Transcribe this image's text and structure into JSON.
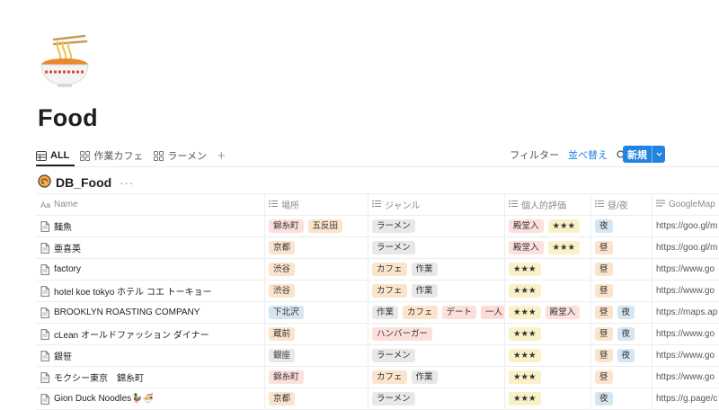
{
  "page": {
    "icon": "noodle-bowl-icon",
    "title": "Food"
  },
  "views": {
    "tabs": [
      {
        "label": "ALL",
        "icon": "table-icon",
        "active": true
      },
      {
        "label": "作業カフェ",
        "icon": "gallery-icon",
        "active": false
      },
      {
        "label": "ラーメン",
        "icon": "gallery-icon",
        "active": false
      }
    ],
    "add": "+"
  },
  "toolbar": {
    "filter": "フィルター",
    "sort": "並べ替え",
    "new": "新規"
  },
  "database": {
    "icon": "noodle-bowl-icon",
    "title": "DB_Food",
    "more": "···"
  },
  "table": {
    "headers": {
      "name": "Name",
      "place": "場所",
      "genre": "ジャンル",
      "rating": "個人的評価",
      "time": "昼/夜",
      "gmap": "GoogleMap"
    },
    "rows": [
      {
        "name": "麺魚",
        "place": [
          "錦糸町",
          "五反田"
        ],
        "genre": [
          "ラーメン"
        ],
        "rating": [
          "殿堂入",
          "★★★"
        ],
        "time": [
          "夜"
        ],
        "gmap": "https://goo.gl/m"
      },
      {
        "name": "亜喜英",
        "place": [
          "京都"
        ],
        "genre": [
          "ラーメン"
        ],
        "rating": [
          "殿堂入",
          "★★★"
        ],
        "time": [
          "昼"
        ],
        "gmap": "https://goo.gl/m"
      },
      {
        "name": "factory",
        "place": [
          "渋谷"
        ],
        "genre": [
          "カフェ",
          "作業"
        ],
        "rating": [
          "★★★"
        ],
        "time": [
          "昼"
        ],
        "gmap": "https://www.go"
      },
      {
        "name": "hotel koe tokyo ホテル コエ トーキョー",
        "place": [
          "渋谷"
        ],
        "genre": [
          "カフェ",
          "作業"
        ],
        "rating": [
          "★★★"
        ],
        "time": [
          "昼"
        ],
        "gmap": "https://www.go"
      },
      {
        "name": "BROOKLYN ROASTING COMPANY",
        "place": [
          "下北沢"
        ],
        "genre": [
          "作業",
          "カフェ",
          "デート",
          "一人"
        ],
        "rating": [
          "★★★",
          "殿堂入"
        ],
        "time": [
          "昼",
          "夜"
        ],
        "gmap": "https://maps.ap"
      },
      {
        "name": "cLean オールドファッション ダイナー",
        "place": [
          "蔵前"
        ],
        "genre": [
          "ハンバーガー"
        ],
        "rating": [
          "★★★"
        ],
        "time": [
          "昼",
          "夜"
        ],
        "gmap": "https://www.go"
      },
      {
        "name": "銀笹",
        "place": [
          "銀座"
        ],
        "genre": [
          "ラーメン"
        ],
        "rating": [
          "★★★"
        ],
        "time": [
          "昼",
          "夜"
        ],
        "gmap": "https://www.go"
      },
      {
        "name": "モクシー東京　錦糸町",
        "place": [
          "錦糸町"
        ],
        "genre": [
          "カフェ",
          "作業"
        ],
        "rating": [
          "★★★"
        ],
        "time": [
          "昼"
        ],
        "gmap": "https://www.go"
      },
      {
        "name": "Gion Duck Noodles🦆🍜",
        "place": [
          "京都"
        ],
        "genre": [
          "ラーメン"
        ],
        "rating": [
          "★★★"
        ],
        "time": [
          "夜"
        ],
        "gmap": "https://g.page/c"
      }
    ]
  },
  "tag_colors": {
    "錦糸町": "#fde0dc",
    "五反田": "#fbe4cc",
    "京都": "#fbe4cc",
    "渋谷": "#fbe4cc",
    "下北沢": "#d5e6f3",
    "蔵前": "#fbe4cc",
    "銀座": "#e8e8e6",
    "ラーメン": "#e8e8e6",
    "カフェ": "#fbe4cc",
    "作業": "#e8e8e6",
    "デート": "#fde0dc",
    "一人": "#fbdcd8",
    "ハンバーガー": "#fde0dc",
    "殿堂入": "#fde0dc",
    "★★★": "#fbf1c8",
    "昼": "#fbe4cc",
    "夜": "#d5e6f3"
  },
  "colors": {
    "accent": "#2383e2",
    "title": "#1f1f1f"
  }
}
